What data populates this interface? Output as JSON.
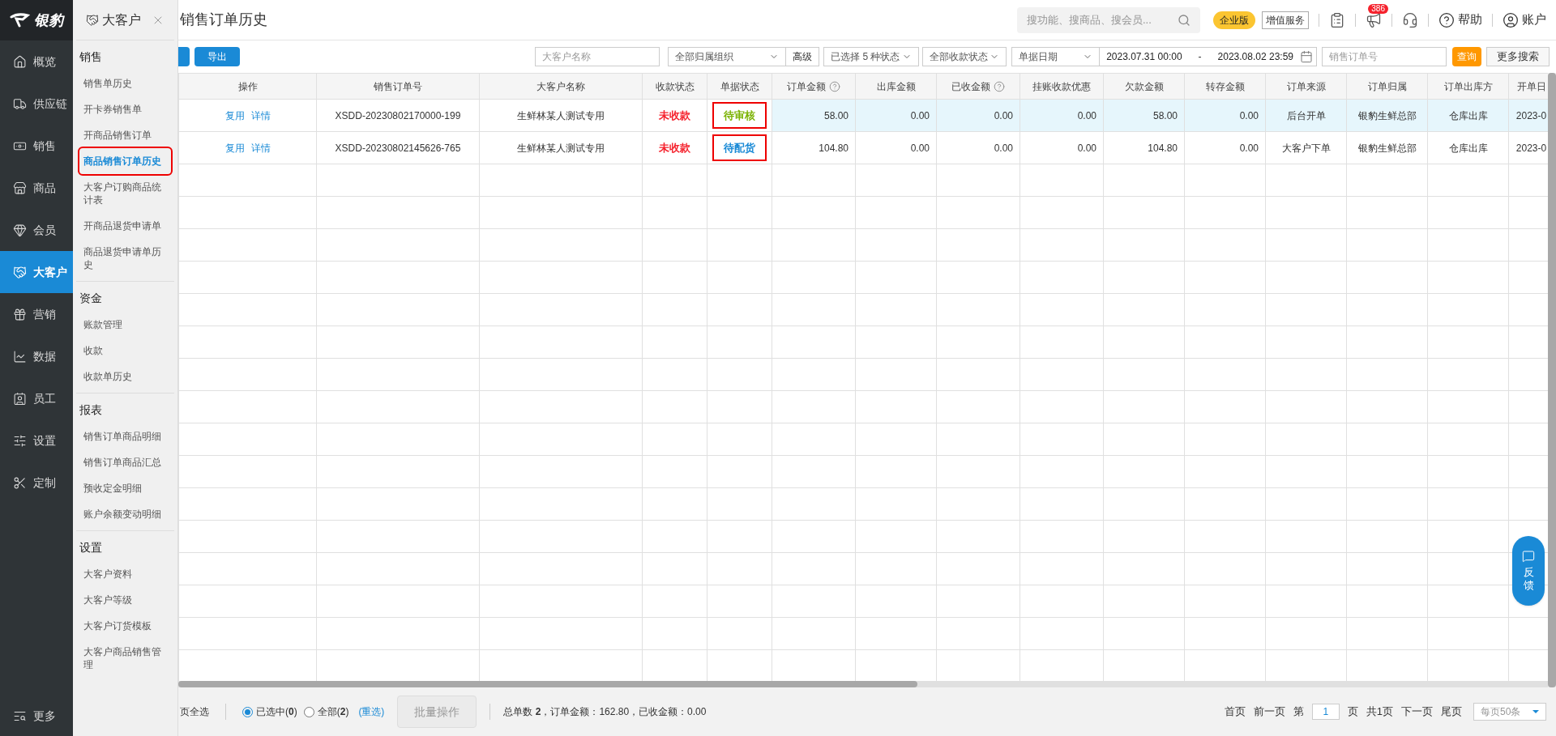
{
  "logo": {
    "text": "银豹"
  },
  "rail": {
    "items": [
      {
        "label": "概览",
        "selected": false
      },
      {
        "label": "供应链",
        "selected": false
      },
      {
        "label": "销售",
        "selected": false
      },
      {
        "label": "商品",
        "selected": false
      },
      {
        "label": "会员",
        "selected": false
      },
      {
        "label": "大客户",
        "selected": true
      },
      {
        "label": "营销",
        "selected": false
      },
      {
        "label": "数据",
        "selected": false
      },
      {
        "label": "员工",
        "selected": false
      },
      {
        "label": "设置",
        "selected": false
      },
      {
        "label": "定制",
        "selected": false
      }
    ],
    "more": "更多"
  },
  "submenu": {
    "title": "大客户",
    "sections": [
      {
        "title": "销售",
        "items": [
          {
            "label": "销售单历史",
            "selected": false
          },
          {
            "label": "开卡券销售单",
            "selected": false
          },
          {
            "label": "开商品销售订单",
            "selected": false
          },
          {
            "label": "商品销售订单历史",
            "selected": true
          },
          {
            "label": "大客户订购商品统计表",
            "selected": false
          },
          {
            "label": "开商品退货申请单",
            "selected": false
          },
          {
            "label": "商品退货申请单历史",
            "selected": false
          }
        ]
      },
      {
        "title": "资金",
        "items": [
          {
            "label": "账款管理",
            "selected": false
          },
          {
            "label": "收款",
            "selected": false
          },
          {
            "label": "收款单历史",
            "selected": false
          }
        ]
      },
      {
        "title": "报表",
        "items": [
          {
            "label": "销售订单商品明细",
            "selected": false
          },
          {
            "label": "销售订单商品汇总",
            "selected": false
          },
          {
            "label": "预收定金明细",
            "selected": false
          },
          {
            "label": "账户余额变动明细",
            "selected": false
          }
        ]
      },
      {
        "title": "设置",
        "items": [
          {
            "label": "大客户资料",
            "selected": false
          },
          {
            "label": "大客户等级",
            "selected": false
          },
          {
            "label": "大客户订货模板",
            "selected": false
          },
          {
            "label": "大客户商品销售管理",
            "selected": false
          }
        ]
      }
    ]
  },
  "header": {
    "title": "销售订单历史",
    "search_placeholder": "搜功能、搜商品、搜会员...",
    "edition": "企业版",
    "value_added": "增值服务",
    "notification_count": "386",
    "help": "帮助",
    "account": "账户"
  },
  "toolbar": {
    "export": "导出",
    "customer_placeholder": "大客户名称",
    "org_select": "全部归属组织",
    "advanced": "高级",
    "status_select": "已选择 5 种状态",
    "payment_select": "全部收款状态",
    "date_type": "单据日期",
    "date_from": "2023.07.31 00:00",
    "date_sep": "-",
    "date_to": "2023.08.02 23:59",
    "order_placeholder": "销售订单号",
    "query": "查询",
    "more_search": "更多搜索"
  },
  "table": {
    "columns": [
      {
        "label": "操作",
        "kind": "center",
        "help": false
      },
      {
        "label": "销售订单号",
        "kind": "center",
        "help": false
      },
      {
        "label": "大客户名称",
        "kind": "center",
        "help": false
      },
      {
        "label": "收款状态",
        "kind": "center",
        "help": false
      },
      {
        "label": "单据状态",
        "kind": "center",
        "help": false
      },
      {
        "label": "订单金额",
        "kind": "number",
        "help": true
      },
      {
        "label": "出库金额",
        "kind": "number",
        "help": false
      },
      {
        "label": "已收金额",
        "kind": "number",
        "help": true
      },
      {
        "label": "挂账收款优惠",
        "kind": "number",
        "help": false
      },
      {
        "label": "欠款金额",
        "kind": "number",
        "help": false
      },
      {
        "label": "转存金额",
        "kind": "number",
        "help": false
      },
      {
        "label": "订单来源",
        "kind": "center",
        "help": false
      },
      {
        "label": "订单归属",
        "kind": "center",
        "help": false
      },
      {
        "label": "订单出库方",
        "kind": "center",
        "help": false
      },
      {
        "label": "开单日",
        "kind": "center",
        "help": false
      }
    ],
    "rows": [
      {
        "selected": true,
        "cells": [
          {
            "kind": "actions",
            "links": [
              "复用",
              "详情"
            ]
          },
          {
            "text": "XSDD-20230802170000-199"
          },
          {
            "text": "生鲜林某人测试专用"
          },
          {
            "text": "未收款",
            "color": "#f5222d"
          },
          {
            "text": "待审核",
            "color": "#7cb305",
            "outlined": true
          },
          {
            "text": "58.00"
          },
          {
            "text": "0.00"
          },
          {
            "text": "0.00"
          },
          {
            "text": "0.00"
          },
          {
            "text": "58.00"
          },
          {
            "text": "0.00"
          },
          {
            "text": "后台开单"
          },
          {
            "text": "银豹生鲜总部"
          },
          {
            "text": "仓库出库"
          },
          {
            "text": "2023-0"
          }
        ]
      },
      {
        "selected": false,
        "cells": [
          {
            "kind": "actions",
            "links": [
              "复用",
              "详情"
            ]
          },
          {
            "text": "XSDD-20230802145626-765"
          },
          {
            "text": "生鲜林某人测试专用"
          },
          {
            "text": "未收款",
            "color": "#f5222d"
          },
          {
            "text": "待配货",
            "color": "#1a8ad6",
            "outlined": true
          },
          {
            "text": "104.80"
          },
          {
            "text": "0.00"
          },
          {
            "text": "0.00"
          },
          {
            "text": "0.00"
          },
          {
            "text": "104.80"
          },
          {
            "text": "0.00"
          },
          {
            "text": "大客户下单"
          },
          {
            "text": "银豹生鲜总部"
          },
          {
            "text": "仓库出库"
          },
          {
            "text": "2023-0"
          }
        ]
      }
    ]
  },
  "footer": {
    "select_page": "页全选",
    "radios": [
      {
        "label": "已选中(**0**)",
        "selected": true
      },
      {
        "label": "全部(**2**)",
        "selected": false
      }
    ],
    "reselect": "(重选)",
    "batch": {
      "label": "批量操作",
      "disabled": true
    },
    "summary": "总单数 **2**，订单金额：162.80，已收金额：0.00",
    "pager": {
      "first": "首页",
      "prev": "前一页",
      "page_prefix": "第",
      "page": "1",
      "page_suffix": "页",
      "total": "共1页",
      "next": "下一页",
      "last": "尾页",
      "per_page": "每页50条"
    }
  },
  "feedback": "反馈"
}
